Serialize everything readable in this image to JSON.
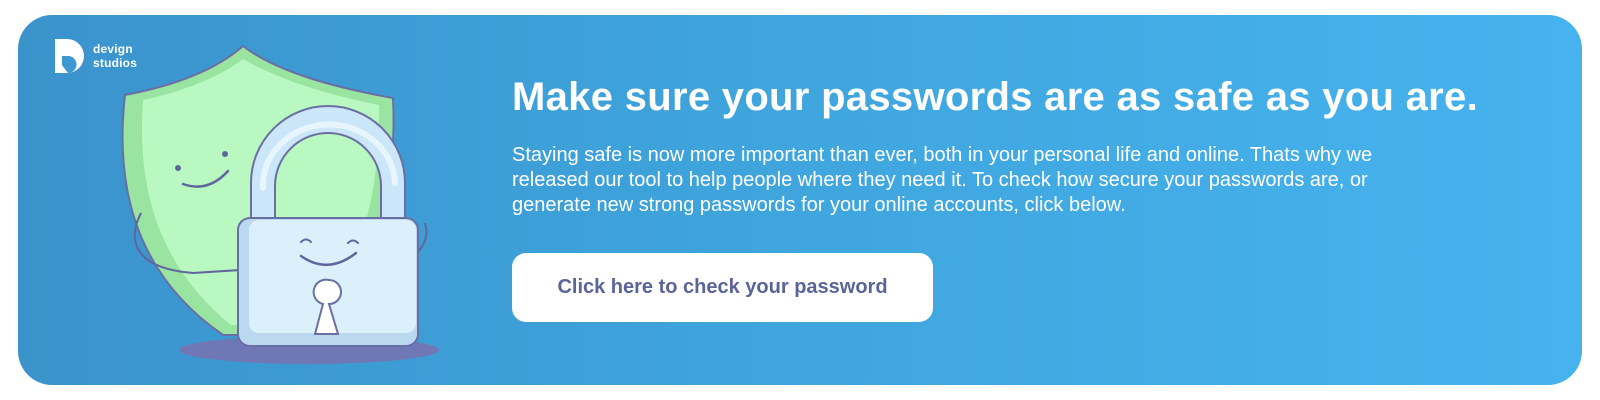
{
  "brand": {
    "line1": "devign",
    "line2": "studios"
  },
  "icons": {
    "logo": "devign-logo-icon",
    "illustration": "shield-and-padlock-illustration"
  },
  "banner": {
    "headline": "Make sure your passwords are as safe as you are.",
    "body": "Staying safe is now more important than ever, both in your personal life and online. Thats why we released our tool to help people where they need it. To check how secure your passwords are, or generate new strong passwords for your online accounts, click below.",
    "cta_label": "Click here to check your password"
  },
  "colors": {
    "background_start": "#3b93cc",
    "background_end": "#46b3ee",
    "cta_text": "#5a6499",
    "shield_green": "#b6f5bd",
    "padlock_blue": "#d9eefa"
  }
}
